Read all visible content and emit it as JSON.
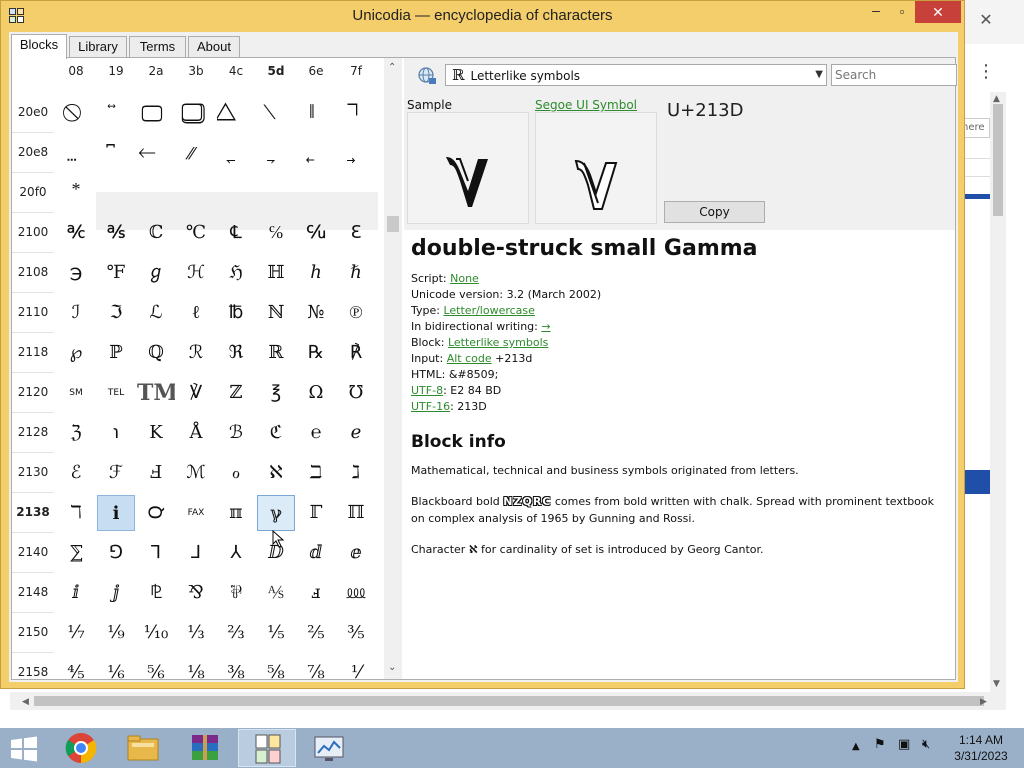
{
  "window": {
    "title": "Unicodia — encyclopedia of characters",
    "min_glyph": "‒",
    "max_glyph": "▫",
    "close_glyph": "✕"
  },
  "tabs": [
    {
      "label": "Blocks",
      "active": true
    },
    {
      "label": "Library"
    },
    {
      "label": "Terms"
    },
    {
      "label": "About"
    }
  ],
  "grid": {
    "columns": [
      "08",
      "19",
      "2a",
      "3b",
      "4c",
      "5d",
      "6e",
      "7f"
    ],
    "rows": [
      {
        "label": "20e0",
        "cells": [
          "⃠",
          "⃡",
          "⃢",
          "⃣",
          "⃤",
          "⃥",
          "⃦",
          "⃧"
        ]
      },
      {
        "label": "20e8",
        "cells": [
          "⃨",
          "⃩",
          "⃪",
          "⃫",
          "⃬",
          "⃭",
          "⃮",
          "⃯"
        ]
      },
      {
        "label": "20f0",
        "cells": [
          "⃰",
          "",
          "",
          "",
          "",
          "",
          "",
          ""
        ]
      },
      {
        "label": "2100",
        "cells": [
          "℀",
          "℁",
          "ℂ",
          "℃",
          "℄",
          "℅",
          "℆",
          "ℇ"
        ]
      },
      {
        "label": "2108",
        "cells": [
          "℈",
          "℉",
          "ℊ",
          "ℋ",
          "ℌ",
          "ℍ",
          "ℎ",
          "ℏ"
        ]
      },
      {
        "label": "2110",
        "cells": [
          "ℐ",
          "ℑ",
          "ℒ",
          "ℓ",
          "℔",
          "ℕ",
          "№",
          "℗"
        ]
      },
      {
        "label": "2118",
        "cells": [
          "℘",
          "ℙ",
          "ℚ",
          "ℛ",
          "ℜ",
          "ℝ",
          "℞",
          "℟"
        ]
      },
      {
        "label": "2120",
        "cells": [
          "SM",
          "TEL",
          "TM",
          "℣",
          "ℤ",
          "℥",
          "Ω",
          "℧"
        ]
      },
      {
        "label": "2128",
        "cells": [
          "ℨ",
          "℩",
          "K",
          "Å",
          "ℬ",
          "ℭ",
          "℮",
          "ℯ"
        ]
      },
      {
        "label": "2130",
        "cells": [
          "ℰ",
          "ℱ",
          "Ⅎ",
          "ℳ",
          "ℴ",
          "ℵ",
          "ℶ",
          "ℷ"
        ]
      },
      {
        "label": "2138",
        "cells": [
          "ℸ",
          "ℹ",
          "℺",
          "FAX",
          "ℼ",
          "ℽ",
          "ℾ",
          "ℿ"
        ]
      },
      {
        "label": "2140",
        "cells": [
          "⅀",
          "⅁",
          "⅂",
          "⅃",
          "⅄",
          "ⅅ",
          "ⅆ",
          "ⅇ"
        ]
      },
      {
        "label": "2148",
        "cells": [
          "ⅈ",
          "ⅉ",
          "⅊",
          "⅋",
          "⅌",
          "⅍",
          "ⅎ",
          "⅏"
        ]
      },
      {
        "label": "2150",
        "cells": [
          "⅐",
          "⅑",
          "⅒",
          "⅓",
          "⅔",
          "⅕",
          "⅖",
          "⅗"
        ]
      },
      {
        "label": "2158",
        "cells": [
          "⅘",
          "⅙",
          "⅚",
          "⅛",
          "⅜",
          "⅝",
          "⅞",
          "⅟"
        ]
      }
    ]
  },
  "panel": {
    "block_glyph": "ℝ",
    "block_name": "Letterlike symbols",
    "search_placeholder": "Search",
    "sample_label": "Sample",
    "font_label": "Segoe UI Symbol",
    "code_label": "U+213D",
    "sample_glyph": "ℽ",
    "copy_label": "Copy",
    "char_title": "double-struck small Gamma",
    "script_label": "Script: ",
    "script_value": "None",
    "version_text": "Unicode version: 3.2 (March 2002)",
    "type_label": "Type: ",
    "type_value": "Letter/lowercase",
    "bidi_label": "In bidirectional writing: ",
    "bidi_value": "→",
    "block_label": "Block: ",
    "block_value": "Letterlike symbols",
    "input_label": "Input: ",
    "input_link": "Alt code",
    "input_value": " +213d",
    "html_text": "HTML: &#8509;",
    "utf8_label": "UTF-8",
    "utf8_value": ": E2 84 BD",
    "utf16_label": "UTF-16",
    "utf16_value": ": 213D",
    "block_info_title": "Block info",
    "para1": "Mathematical, technical and business symbols originated from letters.",
    "para2_pre": "Blackboard bold ",
    "para2_bold": "NZQRC",
    "para2_post": " comes from bold written with chalk. Spread with prominent textbook on complex analysis of 1965 by Gunning and Rossi.",
    "para3_pre": "Character ",
    "para3_glyph": "ℵ",
    "para3_post": " for cardinality of set is introduced by Georg Cantor."
  },
  "background": {
    "close_glyph": "✕",
    "menu_glyph": "⋮",
    "field_text": "here"
  },
  "taskbar": {
    "time": "1:14 AM",
    "date": "3/31/2023"
  }
}
